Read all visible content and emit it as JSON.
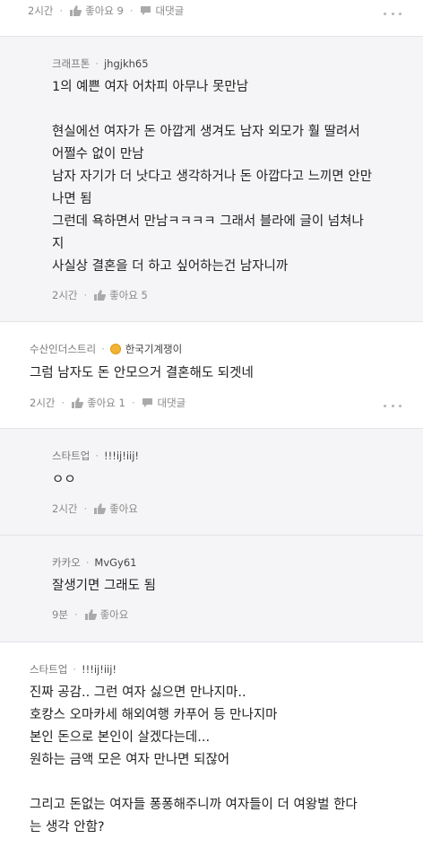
{
  "top": {
    "time": "2시간",
    "like": "좋아요 9",
    "reply": "대댓글"
  },
  "comments": [
    {
      "source": "크래프톤",
      "nick": "jhgjkh65",
      "lines": [
        "1의 예쁜 여자 어차피 아무나 못만남",
        "",
        "현실에선 여자가 돈 아깝게 생겨도 남자 외모가 훨 딸려서",
        "어쩔수 없이 만남",
        "남자 자기가 더 낫다고 생각하거나 돈 아깝다고 느끼면 안만",
        "나면 됨",
        "그런데 욕하면서 만남ㅋㅋㅋㅋ 그래서 블라에 글이 넘쳐나",
        "지",
        "사실상 결혼을 더 하고 싶어하는건 남자니까"
      ],
      "time": "2시간",
      "like": "좋아요 5"
    },
    {
      "source": "수산인더스트리",
      "nick": "한국기계쟁이",
      "lines": [
        "그럼 남자도 돈 안모으거 결혼해도 되겟네"
      ],
      "time": "2시간",
      "like": "좋아요 1",
      "reply": "대댓글"
    },
    {
      "source": "스타트업",
      "nick": "!!!ij!iij!",
      "lines": [
        "ㅇㅇ"
      ],
      "time": "2시간",
      "like": "좋아요"
    },
    {
      "source": "카카오",
      "nick": "MvGy61",
      "lines": [
        "잘생기면 그래도 됨"
      ],
      "time": "9분",
      "like": "좋아요"
    },
    {
      "source": "스타트업",
      "nick": "!!!ij!iij!",
      "lines": [
        "진짜 공감.. 그런 여자 싫으면 만나지마..",
        "호캉스 오마카세 해외여행 카푸어 등 만나지마",
        "본인 돈으로 본인이 살겠다는데...",
        "원하는 금액 모은 여자 만나면 되잖어",
        "",
        "그리고 돈없는 여자들 퐁퐁해주니까 여자들이 더 여왕벌 한다",
        "는 생각 안함?"
      ]
    }
  ]
}
